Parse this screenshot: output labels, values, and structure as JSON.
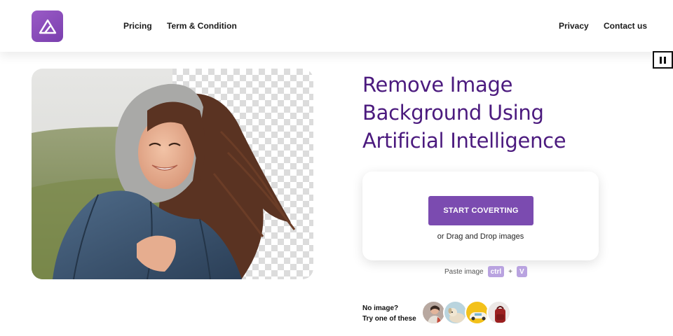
{
  "header": {
    "logo_icon": "mountain-triangle-icon",
    "nav_left": [
      {
        "label": "Pricing"
      },
      {
        "label": "Term & Condition"
      }
    ],
    "nav_right": [
      {
        "label": "Privacy"
      },
      {
        "label": "Contact us"
      }
    ]
  },
  "pause_button": {
    "icon": "pause-icon"
  },
  "hero": {
    "headline_lines": [
      "Remove Image",
      "Background Using",
      "Artificial Intelligence"
    ]
  },
  "upload": {
    "button_label": "START COVERTING",
    "drag_text": "or Drag and Drop images"
  },
  "paste": {
    "label": "Paste image",
    "key1": "ctrl",
    "plus": "+",
    "key2": "V"
  },
  "samples": {
    "label_line1": "No image?",
    "label_line2": "Try one of these",
    "items": [
      "person-sample-icon",
      "dog-sample-icon",
      "car-sample-icon",
      "bag-sample-icon"
    ]
  },
  "colors": {
    "accent": "#7b4bb0",
    "headline": "#4b1a7e",
    "logo": "#8a4dbd",
    "key_bg": "#b9a3e0"
  }
}
